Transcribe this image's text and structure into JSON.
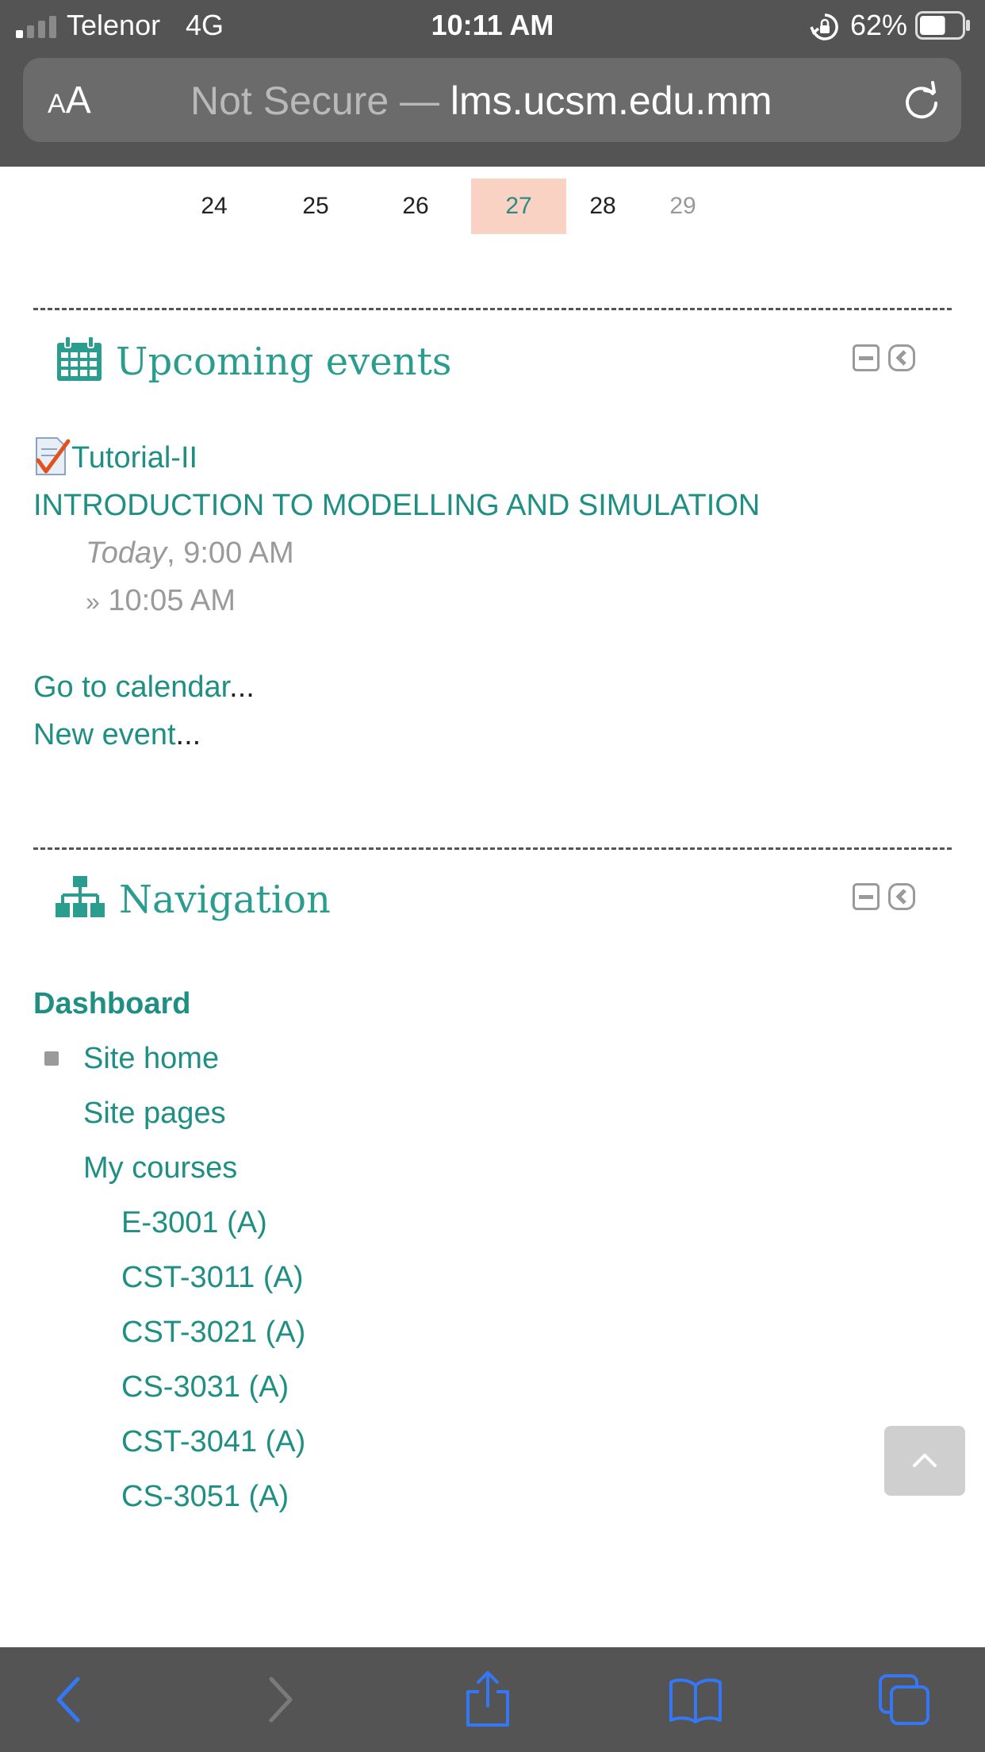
{
  "status_bar": {
    "carrier": "Telenor",
    "network": "4G",
    "time": "10:11 AM",
    "battery": "62%",
    "battery_level": 0.62
  },
  "url_bar": {
    "text_size_label_small": "A",
    "text_size_label_large": "A",
    "security_prefix": "Not Secure — ",
    "host": "lms.ucsm.edu.mm"
  },
  "calendar_row": {
    "days": [
      "24",
      "25",
      "26",
      "27",
      "28",
      "29"
    ],
    "today": "27"
  },
  "upcoming_events": {
    "title": "Upcoming events",
    "event": {
      "name": "Tutorial-II",
      "course": "INTRODUCTION TO MODELLING AND SIMULATION",
      "day_label": "Today",
      "start_time": ", 9:00 AM",
      "end_prefix": "»",
      "end_time": "10:05 AM"
    },
    "go_to_calendar": "Go to calendar",
    "new_event": "New event",
    "ellipsis": "..."
  },
  "navigation": {
    "title": "Navigation",
    "dashboard": "Dashboard",
    "site_home": "Site home",
    "site_pages": "Site pages",
    "my_courses": "My courses",
    "courses": [
      "E-3001 (A)",
      "CST-3011 (A)",
      "CST-3021 (A)",
      "CS-3031 (A)",
      "CST-3041 (A)",
      "CS-3051 (A)"
    ]
  },
  "colors": {
    "accent": "#2a9d8f",
    "today_highlight": "#f9d2c3",
    "chrome": "#545454",
    "toolbar_icon": "#3478f6"
  }
}
